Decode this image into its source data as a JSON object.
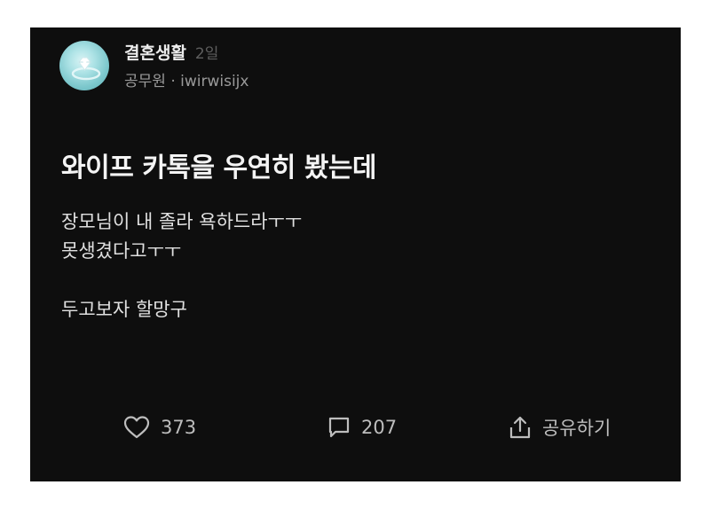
{
  "post": {
    "community": "결혼생활",
    "time_ago": "2일",
    "author_job": "공무원",
    "separator": " · ",
    "author_id": "iwirwisijx",
    "title": "와이프 카톡을 우연히 봤는데",
    "body_lines": [
      "장모님이 내 졸라 욕하드라ㅜㅜ",
      "못생겼다고ㅜㅜ",
      "",
      "두고보자 할망구"
    ]
  },
  "actions": {
    "likes": "373",
    "comments": "207",
    "share_label": "공유하기"
  },
  "icons": {
    "avatar": "ring-icon",
    "like": "heart-icon",
    "comment": "comment-icon",
    "share": "share-icon"
  },
  "colors": {
    "card_background": "#0e0e0e",
    "avatar_background": "#7cc7cc",
    "text_primary": "#f2f2f2",
    "text_secondary": "#9a9a9a"
  }
}
